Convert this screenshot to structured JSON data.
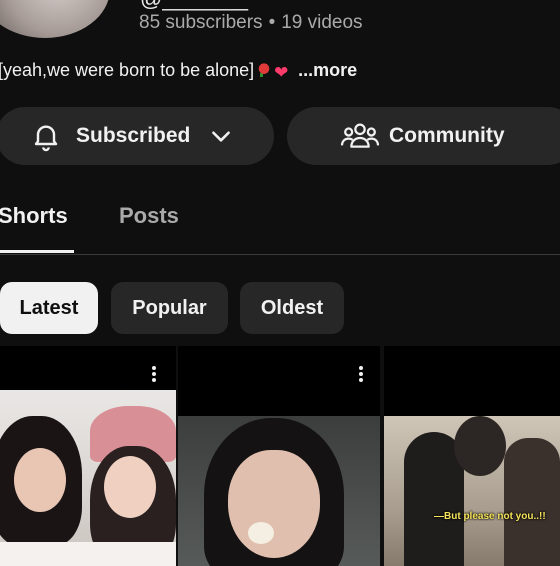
{
  "channel": {
    "handle_partial": "@_______",
    "subscribers": "85 subscribers",
    "separator": "•",
    "videos": "19 videos",
    "bio": "[yeah,we were born to be alone]",
    "bio_more": "...more"
  },
  "buttons": {
    "subscribed_label": "Subscribed",
    "community_label": "Community"
  },
  "tabs": [
    {
      "label": "Shorts",
      "active": true
    },
    {
      "label": "Posts",
      "active": false
    }
  ],
  "chips": [
    {
      "label": "Latest",
      "selected": true
    },
    {
      "label": "Popular",
      "selected": false
    },
    {
      "label": "Oldest",
      "selected": false
    }
  ],
  "shorts": [
    {
      "caption": ""
    },
    {
      "caption": ""
    },
    {
      "caption": "—But please not you..!!"
    }
  ],
  "icons": {
    "bell": "bell-icon",
    "chevron": "chevron-down-icon",
    "community": "people-icon",
    "kebab": "more-vert-icon"
  },
  "colors": {
    "background": "#0f0f0f",
    "surface": "#272727",
    "text": "#f1f1f1",
    "muted": "#aaaaaa",
    "caption": "#f5e35a"
  }
}
